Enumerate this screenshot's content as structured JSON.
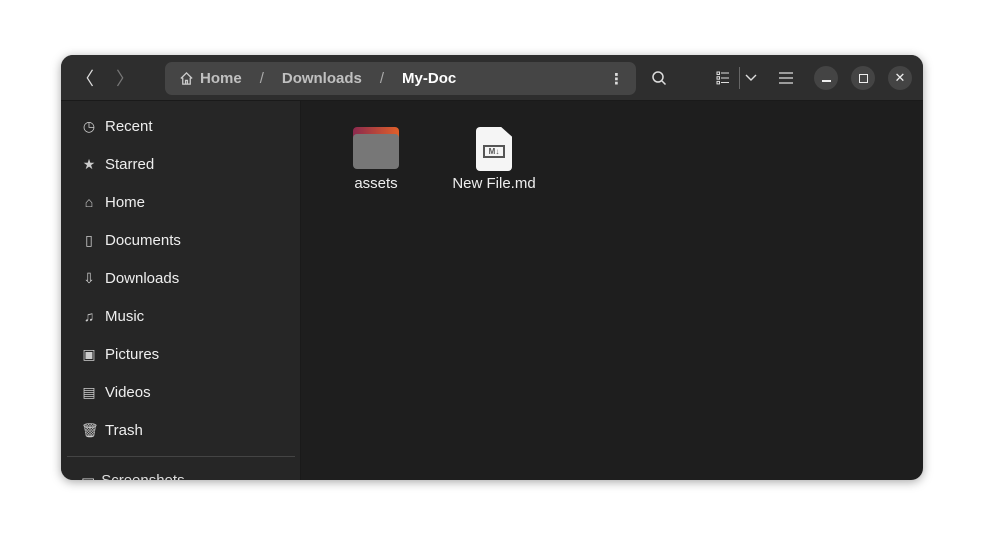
{
  "header": {
    "back_icon": "chevron-left",
    "forward_icon": "chevron-right",
    "breadcrumb": [
      {
        "label": "Home",
        "icon": "home-icon"
      },
      {
        "label": "Downloads"
      },
      {
        "label": "My-Doc"
      }
    ],
    "separator": "/"
  },
  "sidebar": {
    "items": [
      {
        "label": "Recent",
        "icon": "clock-icon"
      },
      {
        "label": "Starred",
        "icon": "star-icon"
      },
      {
        "label": "Home",
        "icon": "home-icon"
      },
      {
        "label": "Documents",
        "icon": "document-icon"
      },
      {
        "label": "Downloads",
        "icon": "download-icon"
      },
      {
        "label": "Music",
        "icon": "music-icon"
      },
      {
        "label": "Pictures",
        "icon": "picture-icon"
      },
      {
        "label": "Videos",
        "icon": "video-icon"
      },
      {
        "label": "Trash",
        "icon": "trash-icon"
      }
    ],
    "bookmark": "Screenshots"
  },
  "files": [
    {
      "name": "assets",
      "type": "folder"
    },
    {
      "name": "New File.md",
      "type": "markdown",
      "badge": "M↓"
    }
  ]
}
